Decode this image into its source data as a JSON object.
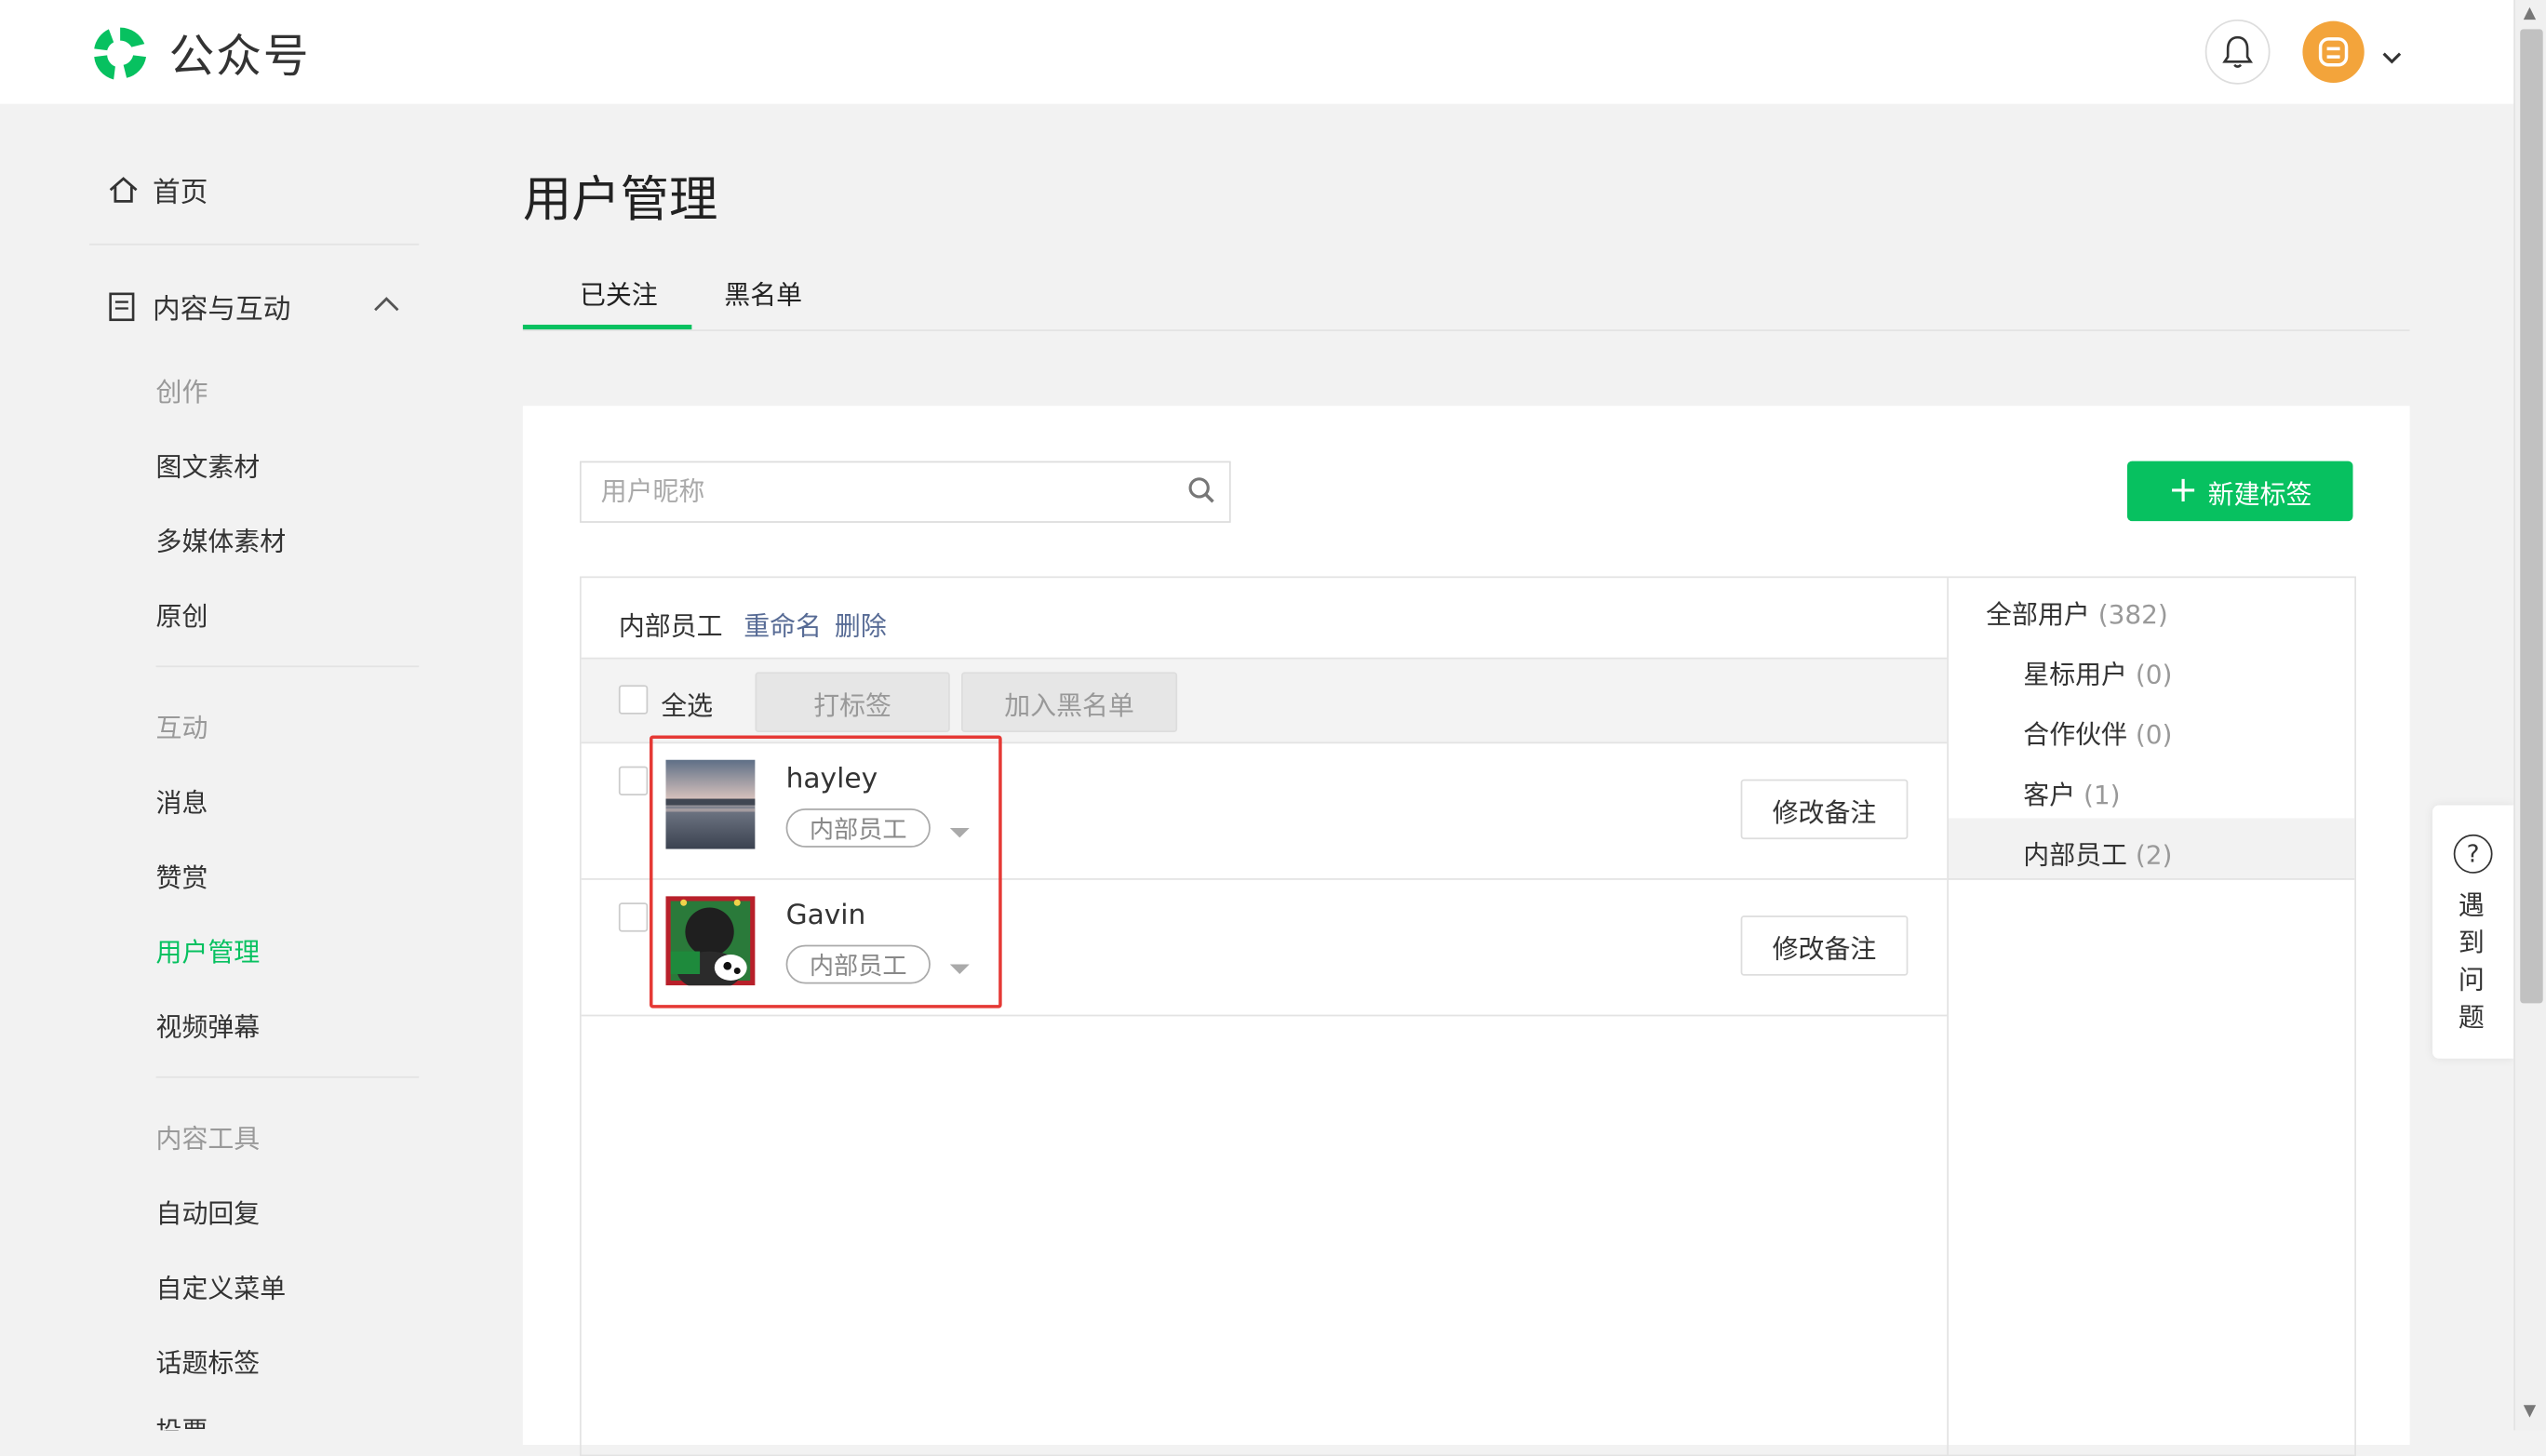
{
  "topbar": {
    "brand": "公众号",
    "logo_icon": "wechat-official-account-logo",
    "bell_icon": "bell-icon",
    "avatar_color": "#f3a43b"
  },
  "sidebar": {
    "home": "首页",
    "section": "内容与互动",
    "groups": [
      {
        "category": "创作",
        "items": [
          "图文素材",
          "多媒体素材",
          "原创"
        ]
      },
      {
        "category": "互动",
        "items": [
          "消息",
          "赞赏",
          "用户管理",
          "视频弹幕"
        ]
      },
      {
        "category": "内容工具",
        "items": [
          "自动回复",
          "自定义菜单",
          "话题标签",
          "投票"
        ]
      }
    ],
    "active_item": "用户管理",
    "accent_color": "#07c160"
  },
  "main": {
    "title": "用户管理",
    "tabs": [
      {
        "label": "已关注",
        "active": true
      },
      {
        "label": "黑名单",
        "active": false
      }
    ],
    "search": {
      "placeholder": "用户昵称",
      "value": ""
    },
    "new_tag_button": "新建标签",
    "group": {
      "name": "内部员工",
      "rename": "重命名",
      "delete": "删除"
    },
    "toolbar": {
      "select_all": "全选",
      "tag_button": "打标签",
      "blacklist_button": "加入黑名单"
    },
    "users": [
      {
        "name": "hayley",
        "tag": "内部员工",
        "edit_button": "修改备注"
      },
      {
        "name": "Gavin",
        "tag": "内部员工",
        "edit_button": "修改备注"
      }
    ],
    "tag_list": [
      {
        "label": "全部用户",
        "count": "(382)"
      },
      {
        "label": "星标用户",
        "count": "(0)"
      },
      {
        "label": "合作伙伴",
        "count": "(0)"
      },
      {
        "label": "客户",
        "count": "(1)"
      },
      {
        "label": "内部员工",
        "count": "(2)",
        "active": true
      }
    ]
  },
  "help": {
    "text": "遇到问题"
  }
}
